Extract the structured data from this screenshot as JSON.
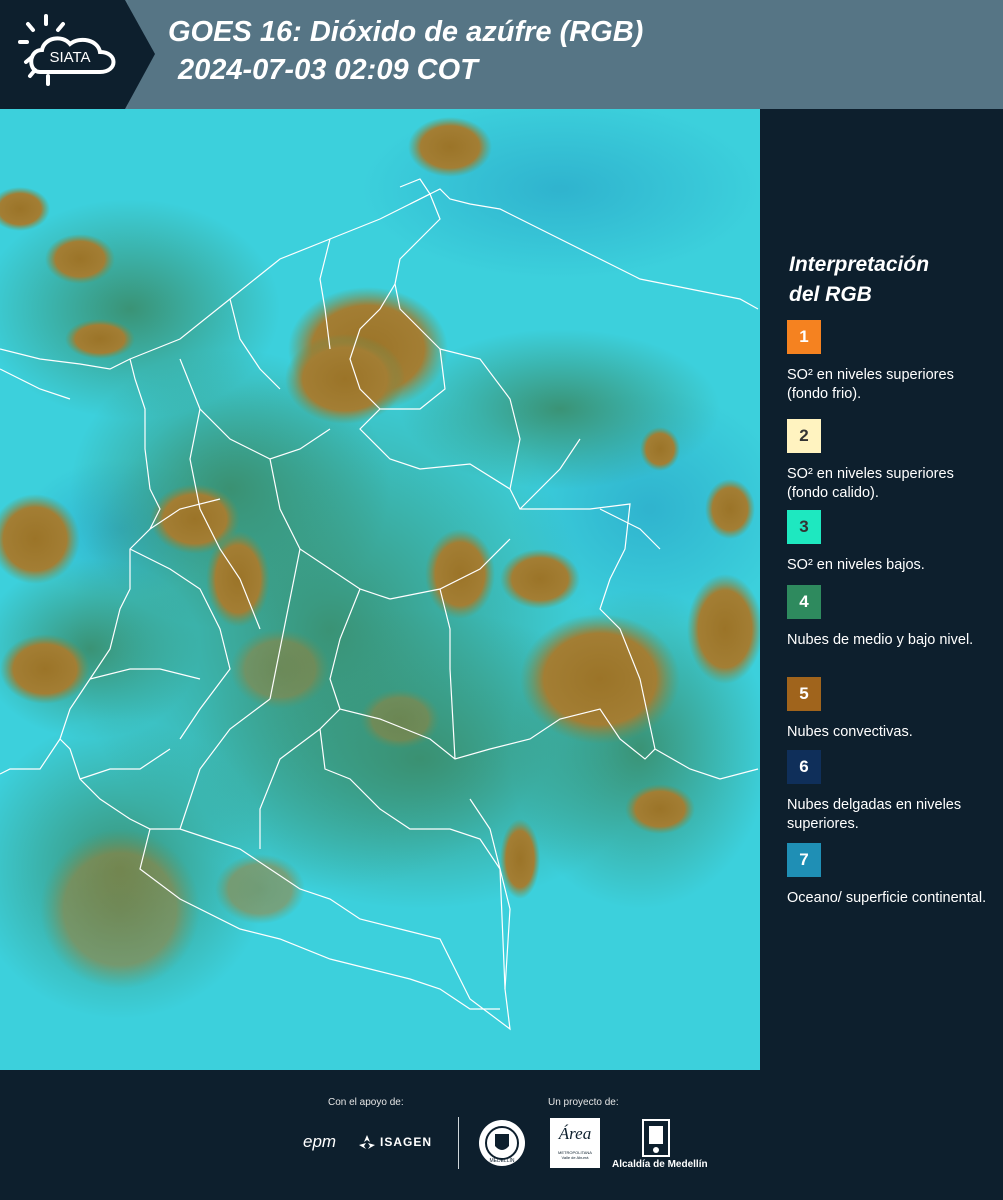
{
  "header": {
    "logo_text": "SIATA",
    "title_line1": "GOES 16: Dióxido de azúfre (RGB)",
    "title_line2": "2024-07-03 02:09 COT"
  },
  "legend": {
    "title_line1": "Interpretación",
    "title_line2": "del RGB",
    "items": [
      {
        "number": "1",
        "color": "#f58220",
        "text": "SO² en niveles superiores (fondo frio)."
      },
      {
        "number": "2",
        "color": "#fff3c0",
        "text": "SO² en niveles superiores (fondo calido)."
      },
      {
        "number": "3",
        "color": "#1ee8c0",
        "text": "SO² en niveles bajos."
      },
      {
        "number": "4",
        "color": "#2e8a5e",
        "text": "Nubes de medio y bajo nivel."
      },
      {
        "number": "5",
        "color": "#a0641c",
        "text": "Nubes convectivas."
      },
      {
        "number": "6",
        "color": "#0f2f5a",
        "text": "Nubes delgadas en niveles superiores."
      },
      {
        "number": "7",
        "color": "#1f8fb5",
        "text": "Oceano/ superficie continental."
      }
    ]
  },
  "footer": {
    "support_label": "Con el apoyo de:",
    "project_label": "Un proyecto de:",
    "sponsor_epm": "epm",
    "sponsor_isagen": "ISAGEN",
    "partner_area_title": "Área",
    "partner_area_sub1": "METROPOLITANA",
    "partner_area_sub2": "Valle de Aburrá",
    "partner_alcaldia": "Alcaldía de Medellín",
    "seal_text": "MEDELLÍN"
  },
  "map": {
    "background_color": "#3ad2dc",
    "convective_color": "#a0782a",
    "vegetation_color": "#3f9a76",
    "border_color": "#ffffff"
  }
}
